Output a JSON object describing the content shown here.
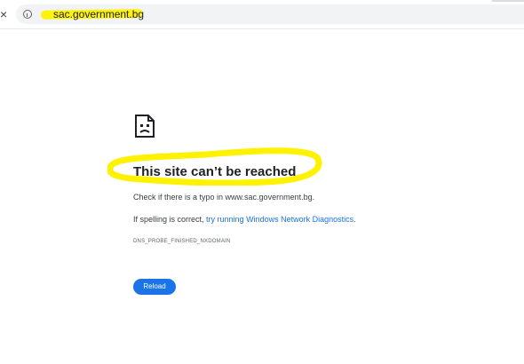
{
  "browser": {
    "address_bar": {
      "url": "sac.government.bg"
    },
    "close_icon_name": "close-icon",
    "info_icon_name": "info-icon"
  },
  "error_page": {
    "icon_name": "sad-page-icon",
    "title": "This site can’t be reached",
    "typo_message": "Check if there is a typo in www.sac.government.bg.",
    "diagnostics_prefix": "If spelling is correct,",
    "diagnostics_link": "try running Windows Network Diagnostics",
    "diagnostics_suffix": ".",
    "error_code": "DNS_PROBE_FINISHED_NXDOMAIN",
    "reload_label": "Reload"
  },
  "colors": {
    "highlight": "#fff200",
    "accent": "#1a73e8",
    "text_primary": "#202124"
  }
}
